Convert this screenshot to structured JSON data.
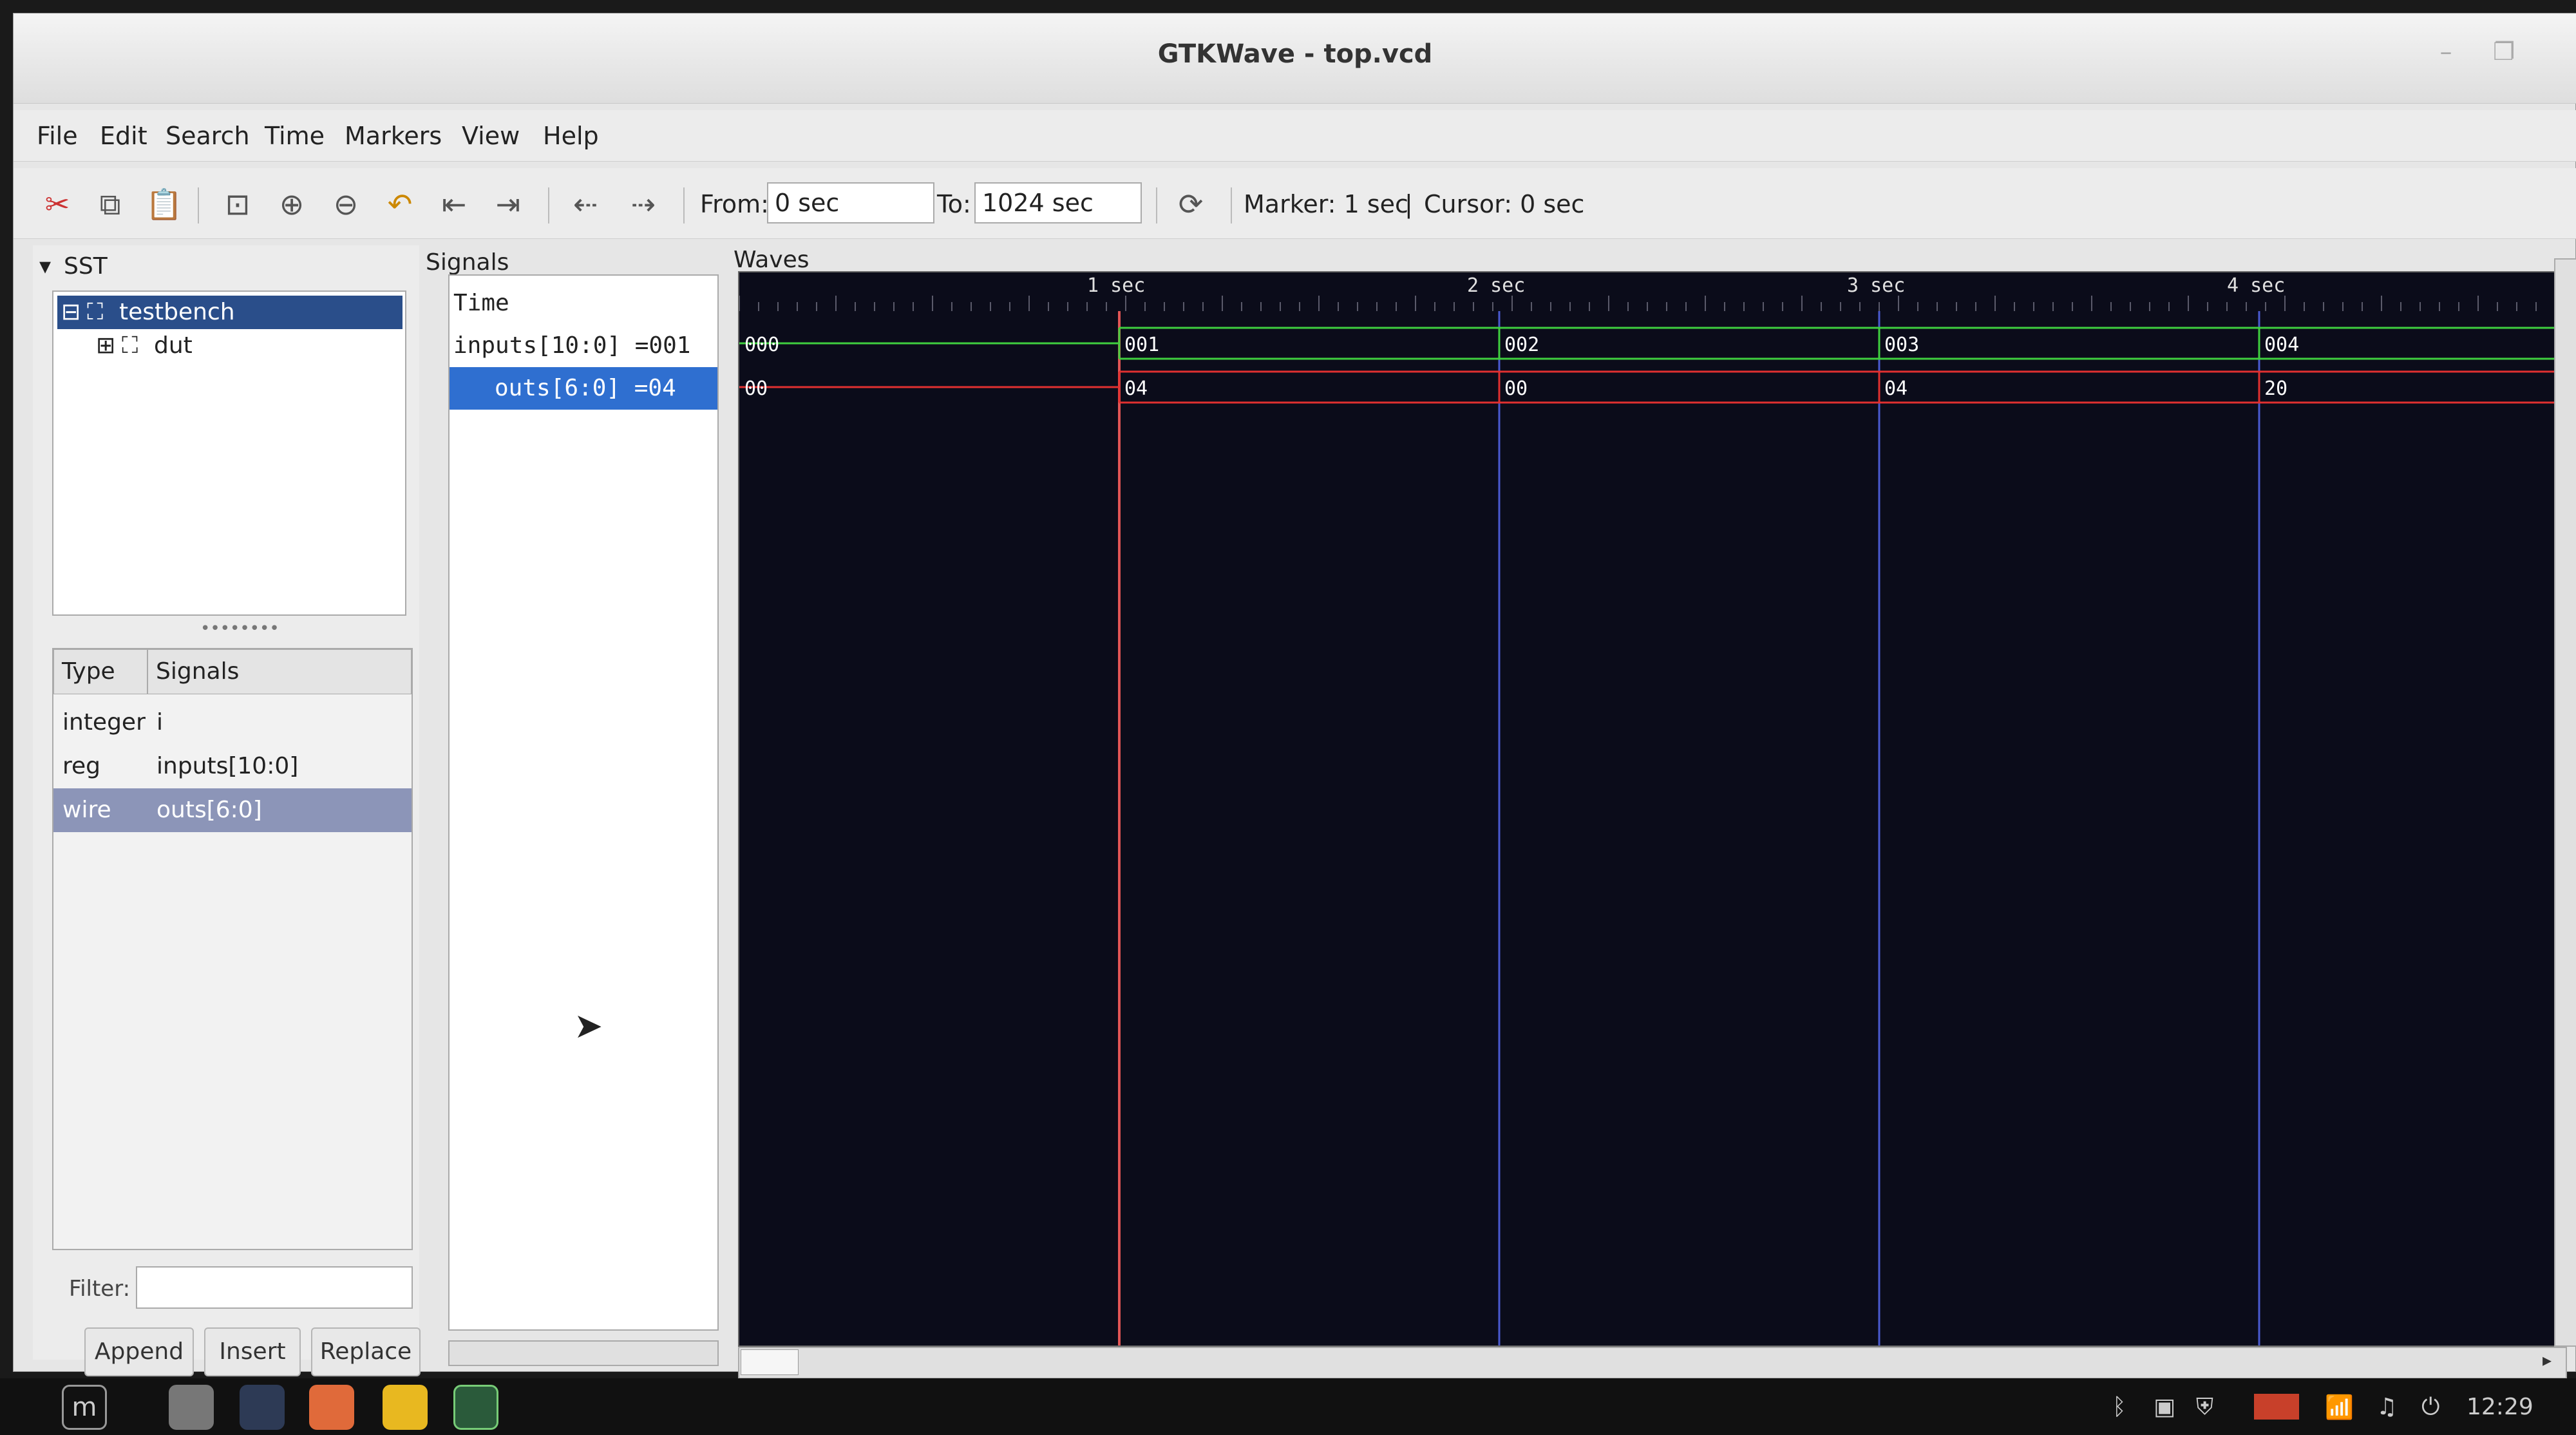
{
  "window": {
    "title": "GTKWave - top.vcd",
    "controls": [
      "minimize",
      "maximize"
    ]
  },
  "menu": {
    "items": [
      "File",
      "Edit",
      "Search",
      "Time",
      "Markers",
      "View",
      "Help"
    ]
  },
  "toolbar": {
    "icons": [
      "cut-icon",
      "copy-icon",
      "paste-icon",
      "zoom-fit-icon",
      "zoom-in-icon",
      "zoom-out-icon",
      "undo-zoom-icon",
      "zoom-start-icon",
      "zoom-end-icon",
      "prev-edge-icon",
      "next-edge-icon",
      "reload-icon"
    ],
    "from_label": "From:",
    "from_value": "0 sec",
    "to_label": "To:",
    "to_value": "1024 sec",
    "marker_text": "Marker: 1 sec",
    "separator": "|",
    "cursor_text": "Cursor: 0 sec"
  },
  "sst": {
    "label": "SST",
    "tree": [
      {
        "label": "testbench",
        "expanded": true,
        "selected": true
      },
      {
        "label": "dut",
        "expanded": false,
        "selected": false
      }
    ],
    "columns": {
      "type": "Type",
      "signals": "Signals"
    },
    "rows": [
      {
        "type": "integer",
        "name": "i",
        "selected": false
      },
      {
        "type": "reg",
        "name": "inputs[10:0]",
        "selected": false
      },
      {
        "type": "wire",
        "name": "outs[6:0]",
        "selected": true
      }
    ],
    "filter_label": "Filter:",
    "filter_value": "",
    "buttons": {
      "append": "Append",
      "insert": "Insert",
      "replace": "Replace"
    }
  },
  "signals": {
    "label": "Signals",
    "rows": [
      {
        "text": "Time",
        "selected": false
      },
      {
        "text": "inputs[10:0] =001",
        "selected": false
      },
      {
        "text": "outs[6:0] =04",
        "selected": true
      }
    ]
  },
  "waves": {
    "label": "Waves",
    "ticks": [
      {
        "t": 1,
        "label": "1 sec"
      },
      {
        "t": 2,
        "label": "2 sec"
      },
      {
        "t": 3,
        "label": "3 sec"
      },
      {
        "t": 4,
        "label": "4 sec"
      }
    ],
    "marker_time": 1,
    "colors": {
      "background": "#0b0c1a",
      "inputs": "#3fcf3f",
      "outs": "#e03030",
      "marker": "#e05555",
      "gridline": "#4a5ad0"
    },
    "traces": [
      {
        "name": "inputs",
        "segments": [
          {
            "start": 0,
            "value": "000"
          },
          {
            "start": 1,
            "value": "001"
          },
          {
            "start": 2,
            "value": "002"
          },
          {
            "start": 3,
            "value": "003"
          },
          {
            "start": 4,
            "value": "004"
          }
        ]
      },
      {
        "name": "outs",
        "segments": [
          {
            "start": 0,
            "value": "00"
          },
          {
            "start": 1,
            "value": "04"
          },
          {
            "start": 2,
            "value": "00"
          },
          {
            "start": 3,
            "value": "04"
          },
          {
            "start": 4,
            "value": "20"
          }
        ]
      }
    ]
  },
  "taskbar": {
    "clock": "12:29"
  }
}
